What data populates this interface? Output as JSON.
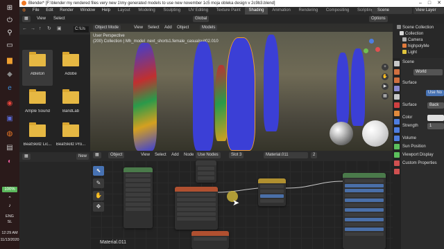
{
  "window": {
    "title": "Blender* [F:\\blender my rendered files very new 1\\my generated models to use new november 1c5 moja obleka design v 2c9b3.blend]"
  },
  "menu": [
    "File",
    "Edit",
    "Render",
    "Window",
    "Help"
  ],
  "workspaces": [
    {
      "label": "Layout",
      "active": false
    },
    {
      "label": "Modeling",
      "active": false
    },
    {
      "label": "Sculpting",
      "active": false
    },
    {
      "label": "UV Editing",
      "active": false
    },
    {
      "label": "Texture Paint",
      "active": false
    },
    {
      "label": "Shading",
      "active": true
    },
    {
      "label": "Animation",
      "active": false
    },
    {
      "label": "Rendering",
      "active": false
    },
    {
      "label": "Compositing",
      "active": false
    },
    {
      "label": "Scripting",
      "active": false
    }
  ],
  "scene_selector": "Scene",
  "view_layer": "View Layer",
  "toolbar": {
    "view": "View",
    "select": "Select",
    "global": "Global",
    "options": "Options"
  },
  "file_browser": {
    "view": "View",
    "select": "Select",
    "path": "C:\\Us",
    "folders": [
      {
        "name": "Ableton",
        "selected": true
      },
      {
        "name": "Adobe",
        "selected": false
      },
      {
        "name": "Ample Sound",
        "selected": false
      },
      {
        "name": "BandLab",
        "selected": false
      },
      {
        "name": "BeatSkillz Lic...",
        "selected": false
      },
      {
        "name": "BeatSkillz Pro...",
        "selected": false
      }
    ]
  },
  "viewport": {
    "mode": "Object Mode",
    "menu": [
      "View",
      "Select",
      "Add",
      "Object"
    ],
    "models": "Models",
    "perspective": "User Perspective",
    "collection_info": "(200) Collection | Mh_model_next_shorts1.female_casualsuit02.010"
  },
  "outliner": {
    "rows": [
      {
        "label": "Scene Collection",
        "color": "#d8d8d8"
      },
      {
        "label": "Collection",
        "color": "#d8d8d8"
      },
      {
        "label": "Camera",
        "color": "#b0b0b0"
      },
      {
        "label": "highpolyMe",
        "color": "#e07a3c"
      },
      {
        "label": "Light",
        "color": "#e0c43c"
      }
    ]
  },
  "properties": {
    "scene": "Scene",
    "world": "World",
    "surface_header": "Surface",
    "use_nodes": "Use No",
    "surface_label": "Surface",
    "surface_value": "Back",
    "color_label": "Color",
    "strength_label": "Strength",
    "strength_value": "1",
    "sections": [
      "Volume",
      "Sun Position",
      "Viewport Display",
      "Custom Properties"
    ]
  },
  "node_editor": {
    "type": "Object",
    "menu": [
      "View",
      "Select",
      "Add",
      "Node"
    ],
    "use_nodes": "Use Nodes",
    "slot": "Slot 3",
    "material": "Material.011",
    "material_users": "2",
    "label": "Material.011",
    "new_button": "New"
  },
  "taskbar": {
    "battery": "100%",
    "lang": "ENG",
    "region": "SL",
    "time": "12:29 AM",
    "date": "11/13/2020"
  }
}
